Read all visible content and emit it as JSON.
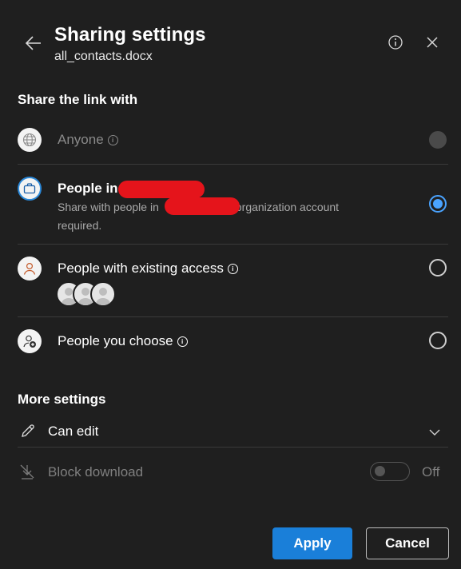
{
  "header": {
    "title": "Sharing settings",
    "filename": "all_contacts.docx"
  },
  "share_section": {
    "heading": "Share the link with",
    "options": [
      {
        "label": "Anyone",
        "state": "disabled"
      },
      {
        "label": "People in",
        "description_part1": "Share with people in",
        "description_part2": "organization account",
        "description_part3": "required.",
        "state": "selected"
      },
      {
        "label": "People with existing access",
        "state": "unselected"
      },
      {
        "label": "People you choose",
        "state": "unselected"
      }
    ]
  },
  "more_settings": {
    "heading": "More settings",
    "permission": "Can edit",
    "block_download_label": "Block download",
    "block_download_state": "Off"
  },
  "footer": {
    "apply_label": "Apply",
    "cancel_label": "Cancel"
  },
  "colors": {
    "background": "#1f1f1f",
    "accent": "#1a7fd9",
    "radio_selected": "#4aa3ff"
  }
}
